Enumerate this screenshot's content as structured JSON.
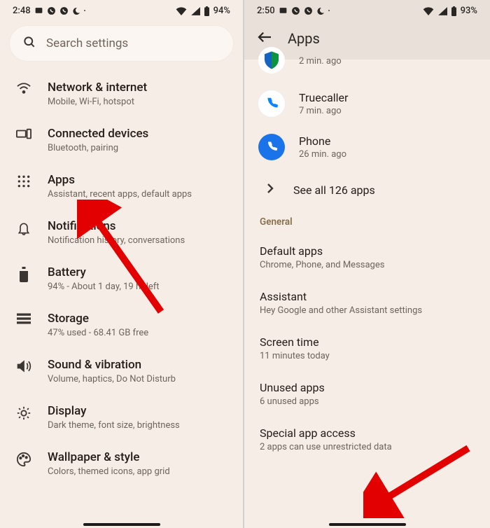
{
  "left": {
    "status": {
      "time": "2:48",
      "battery_pct": "94%"
    },
    "search_placeholder": "Search settings",
    "items": [
      {
        "title": "Network & internet",
        "sub": "Mobile, Wi-Fi, hotspot"
      },
      {
        "title": "Connected devices",
        "sub": "Bluetooth, pairing"
      },
      {
        "title": "Apps",
        "sub": "Assistant, recent apps, default apps"
      },
      {
        "title": "Notifications",
        "sub": "Notification history, conversations"
      },
      {
        "title": "Battery",
        "sub": "94% - About 1 day, 19 hr left"
      },
      {
        "title": "Storage",
        "sub": "47% used - 68.41 GB free"
      },
      {
        "title": "Sound & vibration",
        "sub": "Volume, haptics, Do Not Disturb"
      },
      {
        "title": "Display",
        "sub": "Dark theme, font size, brightness"
      },
      {
        "title": "Wallpaper & style",
        "sub": "Colors, themed icons, app grid"
      }
    ]
  },
  "right": {
    "status": {
      "time": "2:50",
      "battery_pct": "93%"
    },
    "title": "Apps",
    "recent": [
      {
        "name": "",
        "ago": "2 min. ago",
        "partial": true
      },
      {
        "name": "Truecaller",
        "ago": "7 min. ago"
      },
      {
        "name": "Phone",
        "ago": "26 min. ago"
      }
    ],
    "see_all": "See all 126 apps",
    "section_general": "General",
    "general": [
      {
        "title": "Default apps",
        "sub": "Chrome, Phone, and Messages"
      },
      {
        "title": "Assistant",
        "sub": "Hey Google and other Assistant settings"
      },
      {
        "title": "Screen time",
        "sub": "11 minutes today"
      },
      {
        "title": "Unused apps",
        "sub": "6 unused apps"
      },
      {
        "title": "Special app access",
        "sub": "2 apps can use unrestricted data"
      }
    ]
  },
  "annotation": {
    "arrow_target_left": "Apps",
    "arrow_target_right": "Special app access"
  }
}
